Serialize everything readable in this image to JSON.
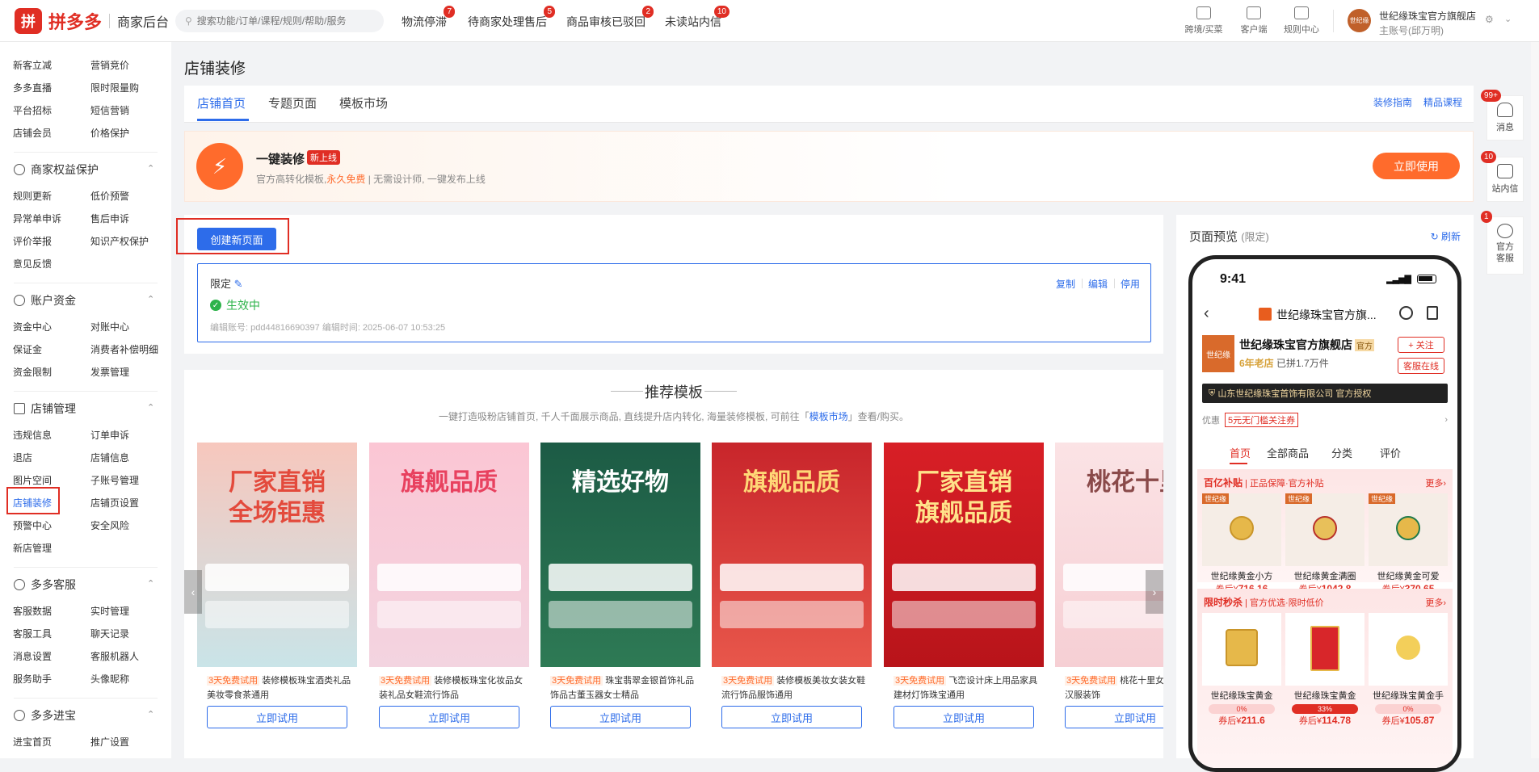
{
  "header": {
    "logo_mark": "拼",
    "logo_text": "拼多多",
    "logo_sub": "商家后台",
    "search_placeholder": "搜索功能/订单/课程/规则/帮助/服务",
    "nav_links": [
      {
        "label": "物流停滞",
        "badge": "7"
      },
      {
        "label": "待商家处理售后",
        "badge": "5"
      },
      {
        "label": "商品审核已驳回",
        "badge": "2"
      },
      {
        "label": "未读站内信",
        "badge": "10"
      }
    ],
    "tools": [
      "跨境/买菜",
      "客户端",
      "规则中心"
    ],
    "account_avatar": "世纪缘",
    "account_name": "世纪缘珠宝官方旗舰店",
    "account_sub": "主账号(邱万明)"
  },
  "sidebar": {
    "top_items": [
      [
        "新客立减",
        "营销竞价"
      ],
      [
        "多多直播",
        "限时限量购"
      ],
      [
        "平台招标",
        "短信营销"
      ],
      [
        "店铺会员",
        "价格保护"
      ]
    ],
    "sections": [
      {
        "title": "商家权益保护",
        "items": [
          [
            "规则更新",
            "低价预警"
          ],
          [
            "异常单申诉",
            "售后申诉"
          ],
          [
            "评价举报",
            "知识产权保护"
          ],
          [
            "意见反馈",
            ""
          ]
        ]
      },
      {
        "title": "账户资金",
        "items": [
          [
            "资金中心",
            "对账中心"
          ],
          [
            "保证金",
            "消费者补偿明细"
          ],
          [
            "资金限制",
            "发票管理"
          ]
        ]
      },
      {
        "title": "店铺管理",
        "items": [
          [
            "违规信息",
            "订单申诉"
          ],
          [
            "退店",
            "店铺信息"
          ],
          [
            "图片空间",
            "子账号管理"
          ],
          [
            "店铺装修",
            "店铺页设置"
          ],
          [
            "预警中心",
            "安全风险"
          ],
          [
            "新店管理",
            ""
          ]
        ]
      },
      {
        "title": "多多客服",
        "items": [
          [
            "客服数据",
            "实时管理"
          ],
          [
            "客服工具",
            "聊天记录"
          ],
          [
            "消息设置",
            "客服机器人"
          ],
          [
            "服务助手",
            "头像昵称"
          ]
        ]
      },
      {
        "title": "多多进宝",
        "items": [
          [
            "进宝首页",
            "推广设置"
          ]
        ]
      }
    ]
  },
  "main": {
    "title": "店铺装修",
    "tabs": [
      "店铺首页",
      "专题页面",
      "模板市场"
    ],
    "links": [
      "装修指南",
      "精品课程"
    ],
    "promo": {
      "title": "一键装修",
      "tag": "新上线",
      "desc_a": "官方高转化模板,",
      "desc_free": "永久免费",
      "desc_b": " | 无需设计师, 一键发布上线",
      "button": "立即使用"
    },
    "create_button": "创建新页面",
    "page_card": {
      "name": "限定",
      "status": "生效中",
      "meta": "编辑账号: pdd44816690397    编辑时间: 2025-06-07 10:53:25",
      "actions": [
        "复制",
        "编辑",
        "停用"
      ]
    },
    "recommend": {
      "title": "推荐模板",
      "sub_a": "一键打造吸粉店铺首页, 千人千面展示商品, 直线提升店内转化, 海量装修模板, 可前往「",
      "sub_link": "模板市场",
      "sub_b": "」查看/购买。",
      "templates": [
        {
          "thumb": "厂家直销",
          "thumb2": "全场钜惠",
          "trial": "3天免费试用",
          "desc": "装修模板珠宝酒类礼品美妆零食茶通用",
          "button": "立即试用",
          "c1": "#f7c7bd",
          "c2": "#c9e4e8",
          "tc": "#e34a3c"
        },
        {
          "thumb": "旗舰品质",
          "thumb2": "",
          "trial": "3天免费试用",
          "desc": "装修模板珠宝化妆品女装礼品女鞋流行饰品",
          "button": "立即试用",
          "c1": "#fbc6d4",
          "c2": "#f3d4e0",
          "tc": "#e8415f"
        },
        {
          "thumb": "精选好物",
          "thumb2": "",
          "trial": "3天免费试用",
          "desc": "珠宝翡翠金银首饰礼品饰品古董玉器女士精品",
          "button": "立即试用",
          "c1": "#1c5b45",
          "c2": "#2e7a55",
          "tc": "#ffffff"
        },
        {
          "thumb": "旗舰品质",
          "thumb2": "",
          "trial": "3天免费试用",
          "desc": "装修模板美妆女装女鞋流行饰品服饰通用",
          "button": "立即试用",
          "c1": "#c8252b",
          "c2": "#e8574b",
          "tc": "#ffd777"
        },
        {
          "thumb": "厂家直销",
          "thumb2": "旗舰品质",
          "trial": "3天免费试用",
          "desc": "飞峦设计床上用品家具建材灯饰珠宝通用",
          "button": "立即试用",
          "c1": "#d81f26",
          "c2": "#b8141a",
          "tc": "#ffe28a"
        },
        {
          "thumb": "桃花十里",
          "thumb2": "",
          "trial": "3天免费试用",
          "desc": "桃花十里女装首饰发饰汉服装饰",
          "button": "立即试用",
          "c1": "#fbe3e5",
          "c2": "#f6cfd4",
          "tc": "#8a4a4a"
        }
      ]
    }
  },
  "preview": {
    "title": "页面预览",
    "limit": "(限定)",
    "refresh": "刷新",
    "phone": {
      "time": "9:41",
      "nav_title": "世纪缘珠宝官方旗...",
      "store_logo": "世纪缘",
      "store_name": "世纪缘珠宝官方旗舰店",
      "official": "官方",
      "store_age": "6年老店",
      "sold": " 已拼1.7万件",
      "follow": "+ 关注",
      "cs": "客服在线",
      "auth": "山东世纪缘珠宝首饰有限公司 官方授权",
      "coupon_label": "优惠",
      "coupon": "5元无门槛关注券",
      "tabs": [
        "首页",
        "全部商品",
        "分类",
        "评价"
      ],
      "sec1": {
        "title": "百亿补贴",
        "sub": " | 正品保障·官方补贴",
        "more": "更多›",
        "products": [
          {
            "brand": "世纪缘",
            "name": "世纪缘黄金小方",
            "price_pre": "券后¥",
            "price": "716.16"
          },
          {
            "brand": "世纪缘",
            "name": "世纪缘黄金满圈",
            "price_pre": "券后¥",
            "price": "1042.8"
          },
          {
            "brand": "世纪缘",
            "name": "世纪缘黄金可爱",
            "price_pre": "券后¥",
            "price": "370.65"
          }
        ]
      },
      "sec2": {
        "title": "限时秒杀",
        "sub": " | 官方优选·限时低价",
        "more": "更多›",
        "products": [
          {
            "name": "世纪缘珠宝黄金",
            "bar": "0%",
            "price_pre": "券后¥",
            "price": "211.6"
          },
          {
            "name": "世纪缘珠宝黄金",
            "bar": "33%",
            "price_pre": "券后¥",
            "price": "114.78"
          },
          {
            "name": "世纪缘珠宝黄金手",
            "bar": "0%",
            "price_pre": "券后¥",
            "price": "105.87"
          }
        ]
      }
    }
  },
  "right_rail": [
    {
      "label": "消息",
      "badge": "99+"
    },
    {
      "label": "站内信",
      "badge": "10"
    },
    {
      "label": "官方客服",
      "badge": "1"
    }
  ]
}
